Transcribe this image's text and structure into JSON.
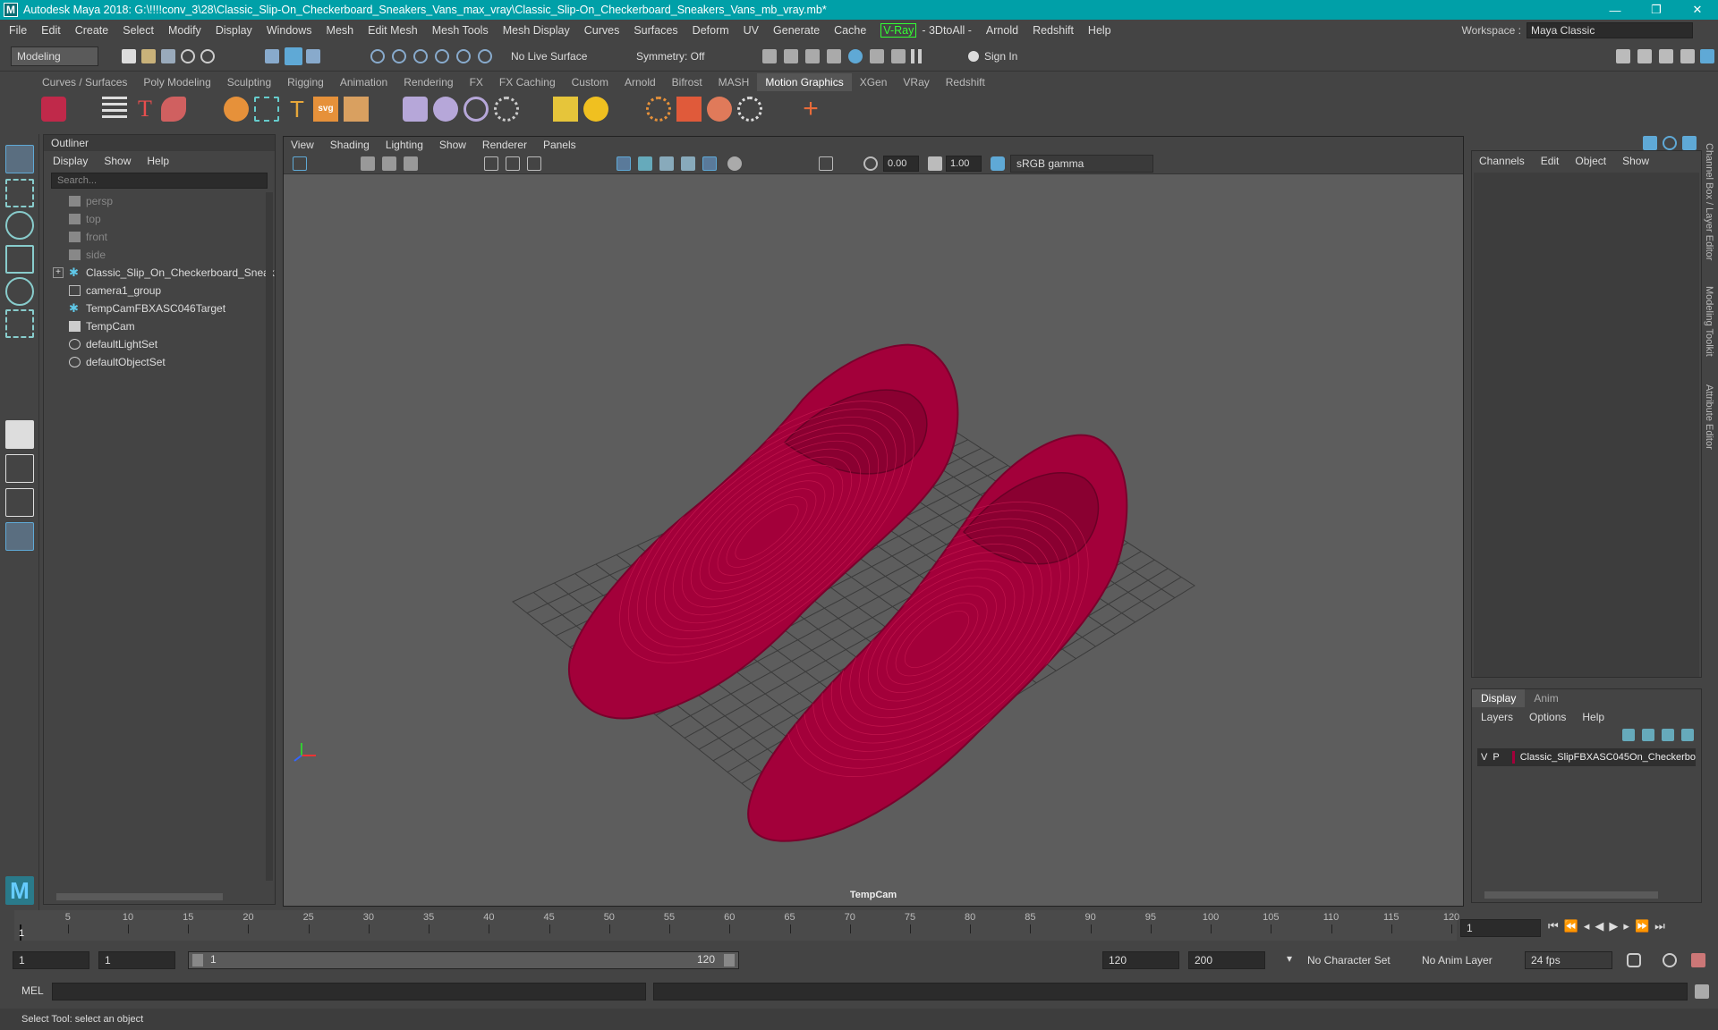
{
  "titlebar": {
    "title": "Autodesk Maya 2018: G:\\!!!!conv_3\\28\\Classic_Slip-On_Checkerboard_Sneakers_Vans_max_vray\\Classic_Slip-On_Checkerboard_Sneakers_Vans_mb_vray.mb*",
    "logo": "M",
    "minimize": "—",
    "restore": "❐",
    "close": "✕"
  },
  "menubar": {
    "items": [
      "File",
      "Edit",
      "Create",
      "Select",
      "Modify",
      "Display",
      "Windows",
      "Mesh",
      "Edit Mesh",
      "Mesh Tools",
      "Mesh Display",
      "Curves",
      "Surfaces",
      "Deform",
      "UV",
      "Generate",
      "Cache"
    ],
    "vray": "V-Ray",
    "items2": [
      "- 3DtoAll -",
      "Arnold",
      "Redshift",
      "Help"
    ],
    "workspace_label": "Workspace :",
    "workspace_value": "Maya Classic"
  },
  "statusline": {
    "mode": "Modeling",
    "live_surface": "No Live Surface",
    "symmetry": "Symmetry: Off",
    "sign_in": "Sign In"
  },
  "shelf": {
    "tabs": [
      "Curves / Surfaces",
      "Poly Modeling",
      "Sculpting",
      "Rigging",
      "Animation",
      "Rendering",
      "FX",
      "FX Caching",
      "Custom",
      "Arnold",
      "Bifrost",
      "MASH",
      "Motion Graphics",
      "XGen",
      "VRay",
      "Redshift"
    ],
    "active": "Motion Graphics"
  },
  "outliner": {
    "title": "Outliner",
    "menu": [
      "Display",
      "Show",
      "Help"
    ],
    "search_placeholder": "Search...",
    "items": [
      {
        "label": "persp",
        "icon": "camera-icon",
        "dim": true
      },
      {
        "label": "top",
        "icon": "camera-icon",
        "dim": true
      },
      {
        "label": "front",
        "icon": "camera-icon",
        "dim": true
      },
      {
        "label": "side",
        "icon": "camera-icon",
        "dim": true
      },
      {
        "label": "Classic_Slip_On_Checkerboard_Sneak",
        "icon": "locator-icon",
        "dim": false,
        "expandable": true
      },
      {
        "label": "camera1_group",
        "icon": "group-icon",
        "dim": false
      },
      {
        "label": "TempCamFBXASC046Target",
        "icon": "locator-icon",
        "dim": false
      },
      {
        "label": "TempCam",
        "icon": "camera-icon",
        "dim": false
      },
      {
        "label": "defaultLightSet",
        "icon": "set-icon",
        "dim": false
      },
      {
        "label": "defaultObjectSet",
        "icon": "set-icon",
        "dim": false
      }
    ]
  },
  "viewport": {
    "menu": [
      "View",
      "Shading",
      "Lighting",
      "Show",
      "Renderer",
      "Panels"
    ],
    "exposure": "0.00",
    "gamma": "1.00",
    "colorspace": "sRGB gamma",
    "camera": "TempCam",
    "wire_color": "#a3003a"
  },
  "channelbox": {
    "menu": [
      "Channels",
      "Edit",
      "Object",
      "Show"
    ]
  },
  "layereditor": {
    "tabs": [
      "Display",
      "Anim"
    ],
    "active": "Display",
    "menu": [
      "Layers",
      "Options",
      "Help"
    ],
    "layer_v": "V",
    "layer_p": "P",
    "layer_name": "Classic_SlipFBXASC045On_Checkerbo",
    "layer_color": "#a3003a"
  },
  "sidetabs": [
    "Channel Box / Layer Editor",
    "Modeling Toolkit",
    "Attribute Editor"
  ],
  "timeslider": {
    "ticks": [
      1,
      5,
      10,
      15,
      20,
      25,
      30,
      35,
      40,
      45,
      50,
      55,
      60,
      65,
      70,
      75,
      80,
      85,
      90,
      95,
      100,
      105,
      110,
      115,
      120
    ],
    "current": "1",
    "current_frame_field": "1"
  },
  "range": {
    "start": "1",
    "playback_start": "1",
    "slider_start": "1",
    "slider_end": "120",
    "playback_end": "120",
    "end": "200",
    "character_set": "No Character Set",
    "anim_layer": "No Anim Layer",
    "fps": "24 fps"
  },
  "cmdline": {
    "label": "MEL"
  },
  "helpline": {
    "text": "Select Tool: select an object"
  }
}
